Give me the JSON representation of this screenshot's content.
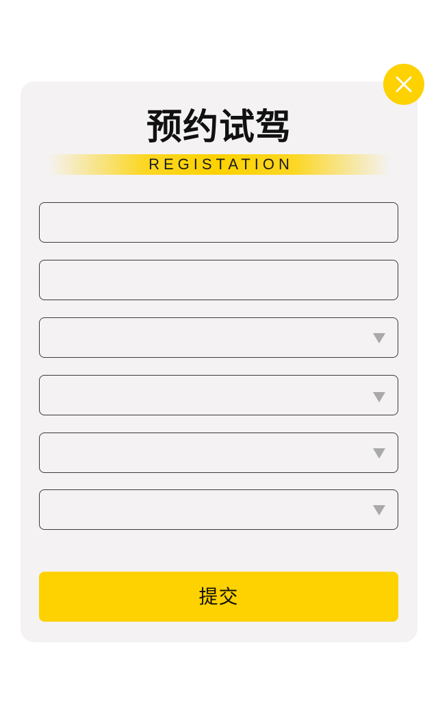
{
  "dialog": {
    "title": "预约试驾",
    "subtitle": "REGISTATION",
    "close_icon": "close-icon",
    "accent_color": "#fdd200"
  },
  "form": {
    "name_field": {
      "value": "",
      "placeholder": ""
    },
    "phone_field": {
      "value": "",
      "placeholder": ""
    },
    "select_1": {
      "value": "",
      "icon": "chevron-down-icon"
    },
    "select_2": {
      "value": "",
      "icon": "chevron-down-icon"
    },
    "select_3": {
      "value": "",
      "icon": "chevron-down-icon"
    },
    "select_4": {
      "value": "",
      "icon": "chevron-down-icon"
    },
    "submit_label": "提交"
  }
}
